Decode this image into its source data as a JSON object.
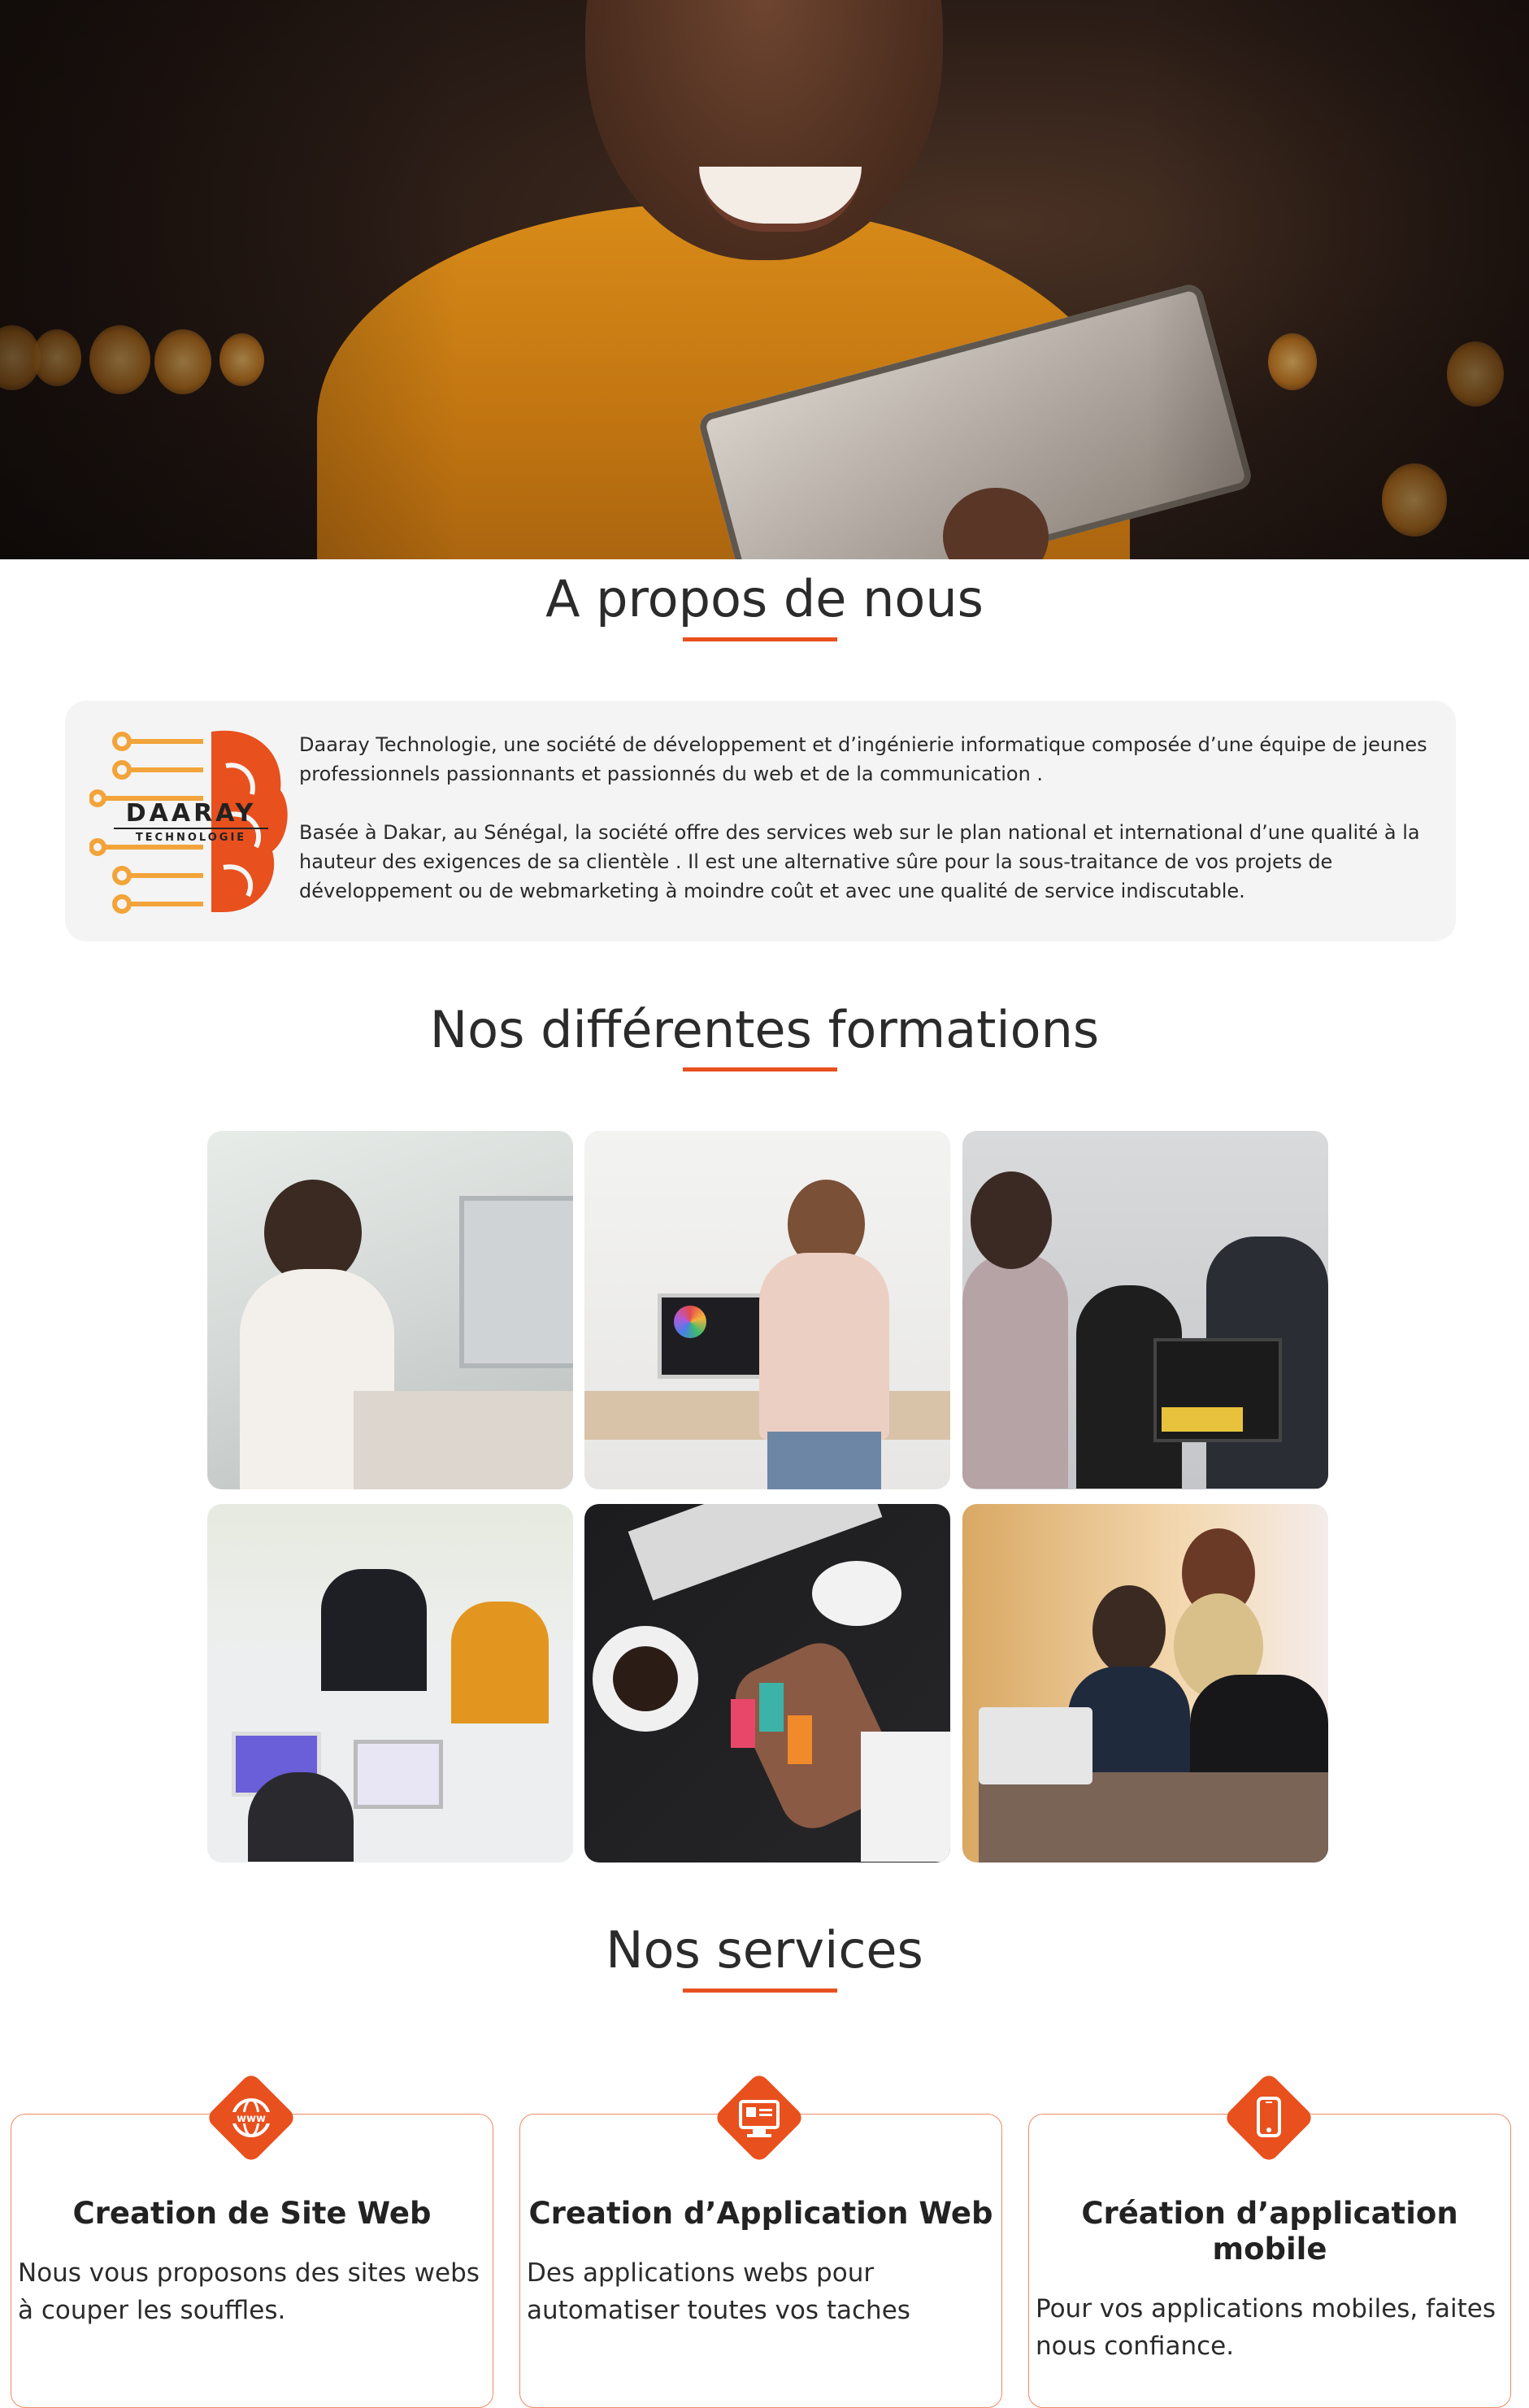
{
  "hero": {
    "image": "woman-with-tablet-photo"
  },
  "about": {
    "title": "A propos de nous",
    "logo_text": "DAARAY",
    "logo_subtext": "TECHNOLOGIE",
    "paragraph_1": "Daaray Technologie, une société de développement et d’ingénierie informatique composée d’une équipe de jeunes professionnels passionnants et passionnés du web et de la communication .",
    "paragraph_2": "Basée à Dakar, au Sénégal, la société offre des services web sur le plan national et international d’une qualité à la hauteur des exigences de sa clientèle . Il est une alternative sûre pour la sous-traitance de vos projets de développement ou de webmarketing à moindre coût et avec une qualité de service indiscutable."
  },
  "formations": {
    "title": "Nos différentes formations",
    "photos": [
      "man-with-tablet-photo",
      "woman-at-desk-photo",
      "group-with-laptop-photo",
      "team-working-photo",
      "desk-topview-photo",
      "colleagues-laptop-photo"
    ]
  },
  "services": {
    "title": "Nos services",
    "items": [
      {
        "icon": "www-icon",
        "title": "Creation de Site Web",
        "description": "Nous vous proposons des sites webs à couper les souffles."
      },
      {
        "icon": "web-app-icon",
        "title": "Creation d’Application Web",
        "description": "Des applications webs pour automatiser toutes vos taches"
      },
      {
        "icon": "mobile-icon",
        "title": "Création d’application mobile",
        "description": "Pour vos applications mobiles, faites nous confiance."
      }
    ]
  },
  "colors": {
    "accent": "#e8501e",
    "card_bg": "#f4f4f4",
    "text": "#2b2b2b"
  }
}
